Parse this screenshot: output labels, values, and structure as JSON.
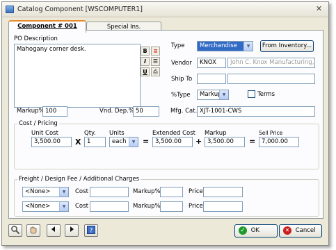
{
  "window": {
    "title": "Catalog Component [WSCOMPUTER1]",
    "close_glyph": "✕"
  },
  "tabs": [
    {
      "label": "Component # 001",
      "active": true
    },
    {
      "label": "Special Ins.",
      "active": false
    }
  ],
  "po_description": {
    "label": "PO Description",
    "text": "Mahogany corner desk."
  },
  "format_buttons": [
    {
      "icon": "bold-icon",
      "glyph": "B"
    },
    {
      "icon": "color-bars-icon",
      "glyph": "≡"
    },
    {
      "icon": "italic-icon",
      "glyph": "I"
    },
    {
      "icon": "align-icon",
      "glyph": "☰"
    },
    {
      "icon": "underline-icon",
      "glyph": "U"
    },
    {
      "icon": "print-icon",
      "glyph": "⎙"
    }
  ],
  "type": {
    "label": "Type",
    "value": "Merchandise",
    "from_inventory_label": "From Inventory..."
  },
  "vendor": {
    "label": "Vendor",
    "code": "KNOX",
    "name": "John C. Knox Manufacturing, In"
  },
  "ship_to": {
    "label": "Ship To",
    "code": "",
    "name": ""
  },
  "pct_type": {
    "label": "%Type",
    "value": "Markup",
    "terms_label": "Terms",
    "terms_checked": false
  },
  "markup_pct": {
    "label": "Markup%",
    "value": "100"
  },
  "vnd_dep_pct": {
    "label": "Vnd. Dep.%",
    "value": "50"
  },
  "mfg_cat": {
    "label": "Mfg. Cat.",
    "value": "XJT-1001-CWS"
  },
  "cost_pricing": {
    "title": "Cost / Pricing",
    "unit_cost": {
      "label": "Unit Cost",
      "value": "3,500.00"
    },
    "times": "X",
    "qty": {
      "label": "Qty.",
      "value": "1"
    },
    "units": {
      "label": "Units",
      "value": "each"
    },
    "equals1": "=",
    "extended_cost": {
      "label": "Extended Cost",
      "value": "3,500.00"
    },
    "plus": "+",
    "markup": {
      "label": "Markup",
      "value": "3,500.00"
    },
    "equals2": "=",
    "sell_price": {
      "label": "Sell Price",
      "value": "7,000.00"
    }
  },
  "freight": {
    "title": "Freight / Design Fee / Additional Charges",
    "rows": [
      {
        "type": "<None>",
        "cost_label": "Cost",
        "cost": "",
        "markup_label": "Markup%",
        "markup": "",
        "price_label": "Price",
        "price": ""
      },
      {
        "type": "<None>",
        "cost_label": "Cost",
        "cost": "",
        "markup_label": "Markup%",
        "markup": "",
        "price_label": "Price",
        "price": ""
      }
    ]
  },
  "footer": {
    "ok_label": "OK",
    "cancel_label": "Cancel",
    "nav_icons": [
      "search-icon",
      "hand-icon",
      "prev-icon",
      "next-icon",
      "help-icon"
    ]
  },
  "colors": {
    "accent": "#316ac5",
    "tab_highlight": "#e68b2c",
    "ok_green": "#1f9a2c",
    "cancel_red": "#c81e1e"
  }
}
